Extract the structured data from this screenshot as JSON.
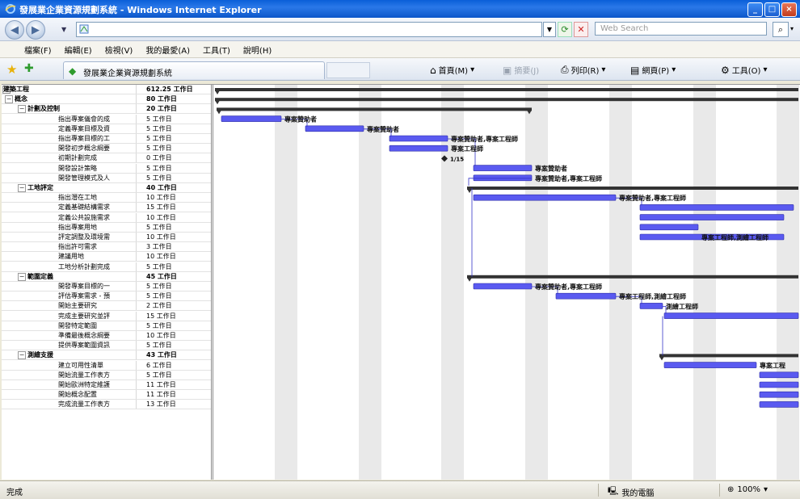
{
  "window": {
    "title": "發展業企業資源規劃系統 - Windows Internet Explorer",
    "buttons": {
      "minimize": "_",
      "maximize": "□",
      "close": "×"
    }
  },
  "address_bar": {
    "back_icon": "back-arrow-icon",
    "forward_icon": "forward-arrow-icon",
    "url": "",
    "search_placeholder": "Web Search"
  },
  "menu": [
    "檔案(F)",
    "編輯(E)",
    "檢視(V)",
    "我的最愛(A)",
    "工具(T)",
    "說明(H)"
  ],
  "tab": {
    "label": "發展業企業資源規劃系統"
  },
  "commands": {
    "home": "首頁(M)",
    "feeds": "摘要(J)",
    "print": "列印(R)",
    "page": "網頁(P)",
    "tools": "工具(O)"
  },
  "tasks": [
    {
      "name": "建築工程",
      "duration": "612.25 工作日",
      "level": 0,
      "summary": true
    },
    {
      "name": "概念",
      "duration": "80 工作日",
      "level": 1,
      "summary": true
    },
    {
      "name": "計劃及控制",
      "duration": "20 工作日",
      "level": 2,
      "summary": true
    },
    {
      "name": "指出專案儀會的成",
      "duration": "5 工作日",
      "level": 3
    },
    {
      "name": "定義專案目標及資",
      "duration": "5 工作日",
      "level": 3
    },
    {
      "name": "指出專案目標的工",
      "duration": "5 工作日",
      "level": 3
    },
    {
      "name": "開發初步概念綱要",
      "duration": "5 工作日",
      "level": 3
    },
    {
      "name": "初期計劃完成",
      "duration": "0 工作日",
      "level": 3
    },
    {
      "name": "開發設計策略",
      "duration": "5 工作日",
      "level": 3
    },
    {
      "name": "開發管理模式及人",
      "duration": "5 工作日",
      "level": 3
    },
    {
      "name": "工地評定",
      "duration": "40 工作日",
      "level": 2,
      "summary": true
    },
    {
      "name": "指出潛在工地",
      "duration": "10 工作日",
      "level": 3
    },
    {
      "name": "定義基礎結構需求",
      "duration": "15 工作日",
      "level": 3
    },
    {
      "name": "定義公共設施需求",
      "duration": "10 工作日",
      "level": 3
    },
    {
      "name": "指出專案用地",
      "duration": "5 工作日",
      "level": 3
    },
    {
      "name": "評定調整及環境需",
      "duration": "10 工作日",
      "level": 3
    },
    {
      "name": "指出許可需求",
      "duration": "3 工作日",
      "level": 3
    },
    {
      "name": "建議用地",
      "duration": "10 工作日",
      "level": 3
    },
    {
      "name": "工地分析計劃完成",
      "duration": "5 工作日",
      "level": 3
    },
    {
      "name": "範圍定義",
      "duration": "45 工作日",
      "level": 2,
      "summary": true
    },
    {
      "name": "開發專案目標的一",
      "duration": "5 工作日",
      "level": 3
    },
    {
      "name": "評估專案需求 - 預",
      "duration": "5 工作日",
      "level": 3
    },
    {
      "name": "開始主要研究",
      "duration": "2 工作日",
      "level": 3
    },
    {
      "name": "完成主要研究並評",
      "duration": "15 工作日",
      "level": 3
    },
    {
      "name": "開發特定範圍",
      "duration": "5 工作日",
      "level": 3
    },
    {
      "name": "準備最後概念綱要",
      "duration": "10 工作日",
      "level": 3
    },
    {
      "name": "提供專案範圍資訊",
      "duration": "5 工作日",
      "level": 3
    },
    {
      "name": "測繪支援",
      "duration": "43 工作日",
      "level": 2,
      "summary": true
    },
    {
      "name": "建立可用性清單",
      "duration": "6 工作日",
      "level": 3
    },
    {
      "name": "開始流量工作表方",
      "duration": "5 工作日",
      "level": 3
    },
    {
      "name": "開始歐洲特定維護",
      "duration": "11 工作日",
      "level": 3
    },
    {
      "name": "開始概念配置",
      "duration": "11 工作日",
      "level": 3
    },
    {
      "name": "完成流量工作表方",
      "duration": "13 工作日",
      "level": 3
    }
  ],
  "resource_labels": [
    "專案贊助者",
    "專案贊助者",
    "專案贊助者,專案工程師",
    "專案工程師",
    "專案贊助者",
    "專案贊助者,專案工程師",
    "專案贊助者,專案工程師",
    "專案工程師,測繪工程師",
    "專案贊助者,專案工程師",
    "專案工程師,測繪工程師",
    "測繪工程師",
    "專案工程"
  ],
  "milestone_label": "1/15",
  "status": {
    "text": "完成",
    "zone": "我的電腦",
    "zoom": "100%"
  }
}
